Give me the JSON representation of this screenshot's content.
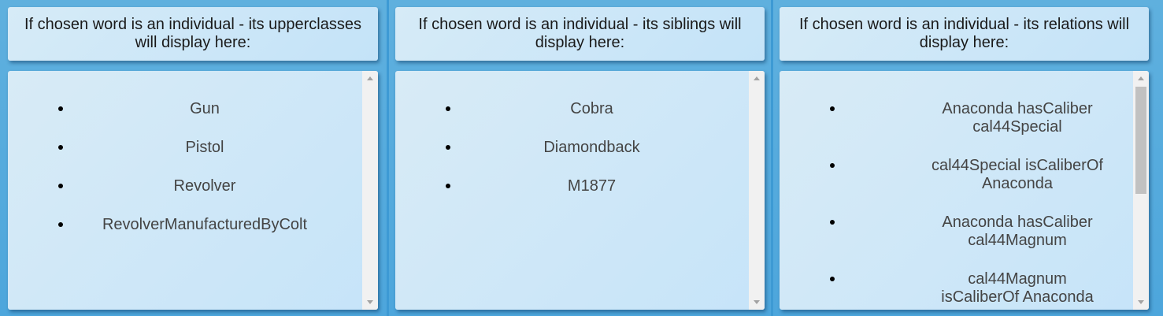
{
  "panels": [
    {
      "header": "If chosen word is an individual - its upperclasses will display here:",
      "items": [
        "Gun",
        "Pistol",
        "Revolver",
        "RevolverManufacturedByColt"
      ]
    },
    {
      "header": "If chosen word is an individual - its siblings will display here:",
      "items": [
        "Cobra",
        "Diamondback",
        "M1877"
      ]
    },
    {
      "header": "If chosen word is an individual - its relations will display here:",
      "items": [
        "Anaconda hasCaliber cal44Special",
        "cal44Special isCaliberOf Anaconda",
        "Anaconda hasCaliber cal44Magnum",
        "cal44Magnum isCaliberOf Anaconda"
      ]
    }
  ],
  "colors": {
    "background": "#4da6dc",
    "panel": "#cfe8f7",
    "text": "#444444",
    "scroll_track": "#f1f1f1",
    "scroll_thumb": "#c1c1c1"
  }
}
